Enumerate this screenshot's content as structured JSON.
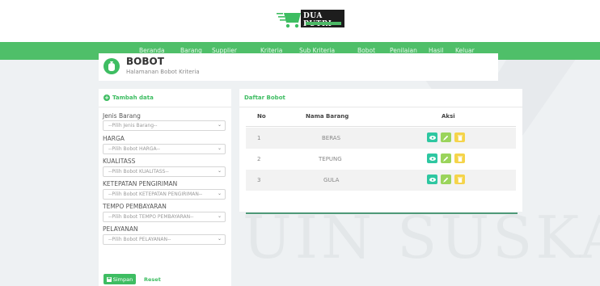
{
  "brand": {
    "name": "DUA PUTRI"
  },
  "nav": {
    "items": [
      "Beranda",
      "Barang",
      "Supplier",
      "Kriteria",
      "Sub Kriteria",
      "Bobot",
      "Penilaian",
      "Hasil",
      "Keluar"
    ]
  },
  "header": {
    "title": "BOBOT",
    "subtitle": "Halamanan Bobot Kriteria"
  },
  "form": {
    "heading": "Tambah data",
    "fields": [
      {
        "label": "Jenis Barang",
        "value": "--Pilih Jenis Barang--"
      },
      {
        "label": "HARGA",
        "value": "--Pilih Bobot HARGA--"
      },
      {
        "label": "KUALITASS",
        "value": "--Pilih Bobot KUALITASS--"
      },
      {
        "label": "KETEPATAN PENGIRIMAN",
        "value": "--Pilih Bobot KETEPATAN PENGIRIMAN--"
      },
      {
        "label": "TEMPO PEMBAYARAN",
        "value": "--Pilih Bobot TEMPO PEMBAYARAN--"
      },
      {
        "label": "PELAYANAN",
        "value": "--Pilih Bobot PELAYANAN--"
      }
    ],
    "save_label": "Simpan",
    "reset_label": "Reset"
  },
  "table": {
    "heading": "Daftar Bobot",
    "columns": [
      "No",
      "Nama Barang",
      "Aksi"
    ],
    "rows": [
      {
        "no": "1",
        "name": "BERAS"
      },
      {
        "no": "2",
        "name": "TEPUNG"
      },
      {
        "no": "3",
        "name": "GULA"
      }
    ]
  },
  "watermark": {
    "text": "UIN SUSKA R"
  },
  "colors": {
    "primary": "#4fbf69",
    "view": "#2ec7a1",
    "edit": "#9ad45b",
    "delete": "#f5d44a"
  }
}
